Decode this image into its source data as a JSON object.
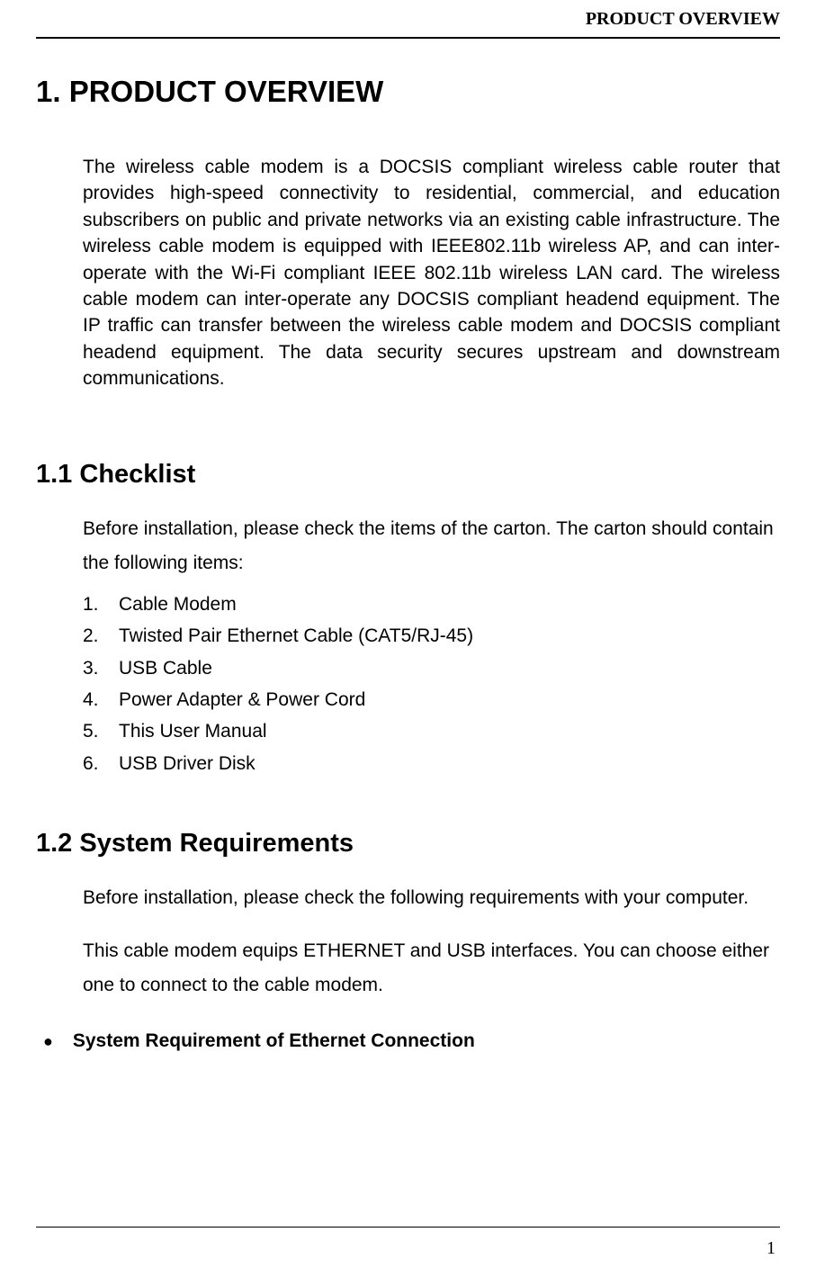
{
  "header": {
    "running_title": "PRODUCT OVERVIEW"
  },
  "section1": {
    "heading": "1. PRODUCT OVERVIEW",
    "paragraph": "The wireless cable modem is a DOCSIS compliant wireless cable router that provides high-speed connectivity to residential, commercial, and education subscribers on public and private networks via an existing cable infrastructure. The wireless cable modem is equipped with IEEE802.11b wireless AP, and can inter-operate with the Wi-Fi compliant IEEE 802.11b wireless LAN card. The wireless cable modem can inter-operate any DOCSIS compliant headend equipment. The IP traffic can transfer between the wireless cable modem and DOCSIS compliant headend equipment. The data security secures upstream and downstream communications."
  },
  "section1_1": {
    "heading": "1.1 Checklist",
    "intro": "Before installation, please check the items of the carton. The carton should contain the following items:",
    "items": [
      {
        "num": "1.",
        "text": "Cable Modem"
      },
      {
        "num": "2.",
        "text": "Twisted Pair Ethernet Cable (CAT5/RJ-45)"
      },
      {
        "num": "3.",
        "text": "USB Cable"
      },
      {
        "num": "4.",
        "text": "Power Adapter & Power Cord"
      },
      {
        "num": "5.",
        "text": "This User Manual"
      },
      {
        "num": "6.",
        "text": "USB Driver Disk"
      }
    ]
  },
  "section1_2": {
    "heading": "1.2 System Requirements",
    "para1": "Before installation, please check the following requirements with your computer.",
    "para2": "This cable modem equips ETHERNET and USB interfaces. You can choose either one to connect to the cable modem.",
    "bullet_heading": "System Requirement of Ethernet Connection"
  },
  "footer": {
    "page_number": "1"
  }
}
